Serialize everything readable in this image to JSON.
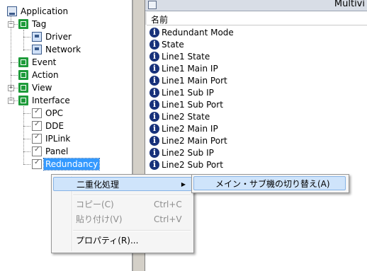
{
  "tree": {
    "root": {
      "label": "Application",
      "icon": "application-icon"
    },
    "nodes": [
      {
        "label": "Tag",
        "icon": "tag-folder-icon",
        "expander": "−"
      },
      {
        "label": "Driver",
        "icon": "driver-icon"
      },
      {
        "label": "Network",
        "icon": "network-icon"
      },
      {
        "label": "Event",
        "icon": "event-icon"
      },
      {
        "label": "Action",
        "icon": "action-icon"
      },
      {
        "label": "View",
        "icon": "view-icon",
        "expander": "+"
      },
      {
        "label": "Interface",
        "icon": "interface-icon",
        "expander": "−"
      },
      {
        "label": "OPC",
        "icon": "document-check-icon"
      },
      {
        "label": "DDE",
        "icon": "document-check-icon"
      },
      {
        "label": "IPLink",
        "icon": "document-check-icon"
      },
      {
        "label": "Panel",
        "icon": "document-check-icon"
      },
      {
        "label": "Redundancy",
        "icon": "document-check-icon",
        "selected": true
      }
    ]
  },
  "right_pane": {
    "title": "Multivi",
    "column_header": "名前",
    "items": [
      "Redundant Mode",
      "State",
      "Line1 State",
      "Line1 Main IP",
      "Line1 Main Port",
      "Line1 Sub IP",
      "Line1 Sub Port",
      "Line2 State",
      "Line2 Main IP",
      "Line2 Main Port",
      "Line2 Sub IP",
      "Line2 Sub Port"
    ],
    "item_icon": "info-icon",
    "info_glyph": "i"
  },
  "context_menu": {
    "redundancy_label": "二重化処理",
    "submenu_arrow": "▶",
    "copy_label": "コピー(C)",
    "copy_shortcut": "Ctrl+C",
    "paste_label": "貼り付け(V)",
    "paste_shortcut": "Ctrl+V",
    "properties_label": "プロパティ(R)..."
  },
  "submenu": {
    "switch_label": "メイン・サブ機の切り替え(A)"
  },
  "colors": {
    "selection": "#3399ff",
    "menu_highlight": "#cfe4fb",
    "tree_icon_green": "#1e9b3a",
    "info_icon": "#17317a"
  }
}
